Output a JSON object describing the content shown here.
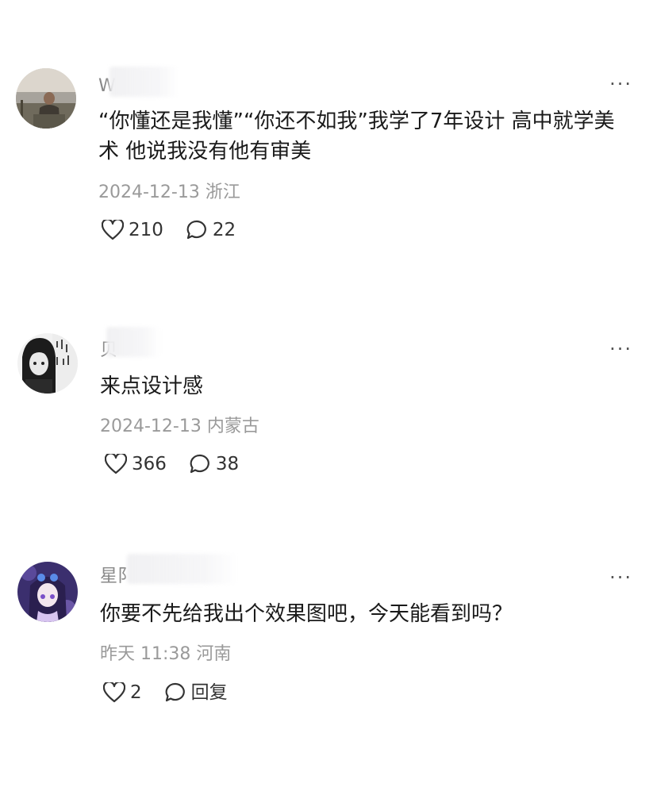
{
  "more_glyph": "···",
  "comments": [
    {
      "username": "W",
      "content": "“你懂还是我懂”“你还不如我”我学了7年设计 高中就学美术 他说我没有他有审美",
      "date": "2024-12-13",
      "location": "浙江",
      "likes": "210",
      "replies": "22",
      "avatar_icon": "photo-avatar-person-icon"
    },
    {
      "username": "贝",
      "content": "来点设计感",
      "date": "2024-12-13",
      "location": "内蒙古",
      "likes": "366",
      "replies": "38",
      "avatar_icon": "anime-avatar-icon"
    },
    {
      "username": "星阝",
      "content": "你要不先给我出个效果图吧，今天能看到吗？",
      "date": "昨天 11:38",
      "location": "河南",
      "likes": "2",
      "replies": "回复",
      "avatar_icon": "anime-avatar-purple-icon"
    }
  ],
  "colors": {
    "text": "#1a1a1a",
    "meta": "#9a9a9a",
    "username": "#888888",
    "icon": "#333333"
  }
}
